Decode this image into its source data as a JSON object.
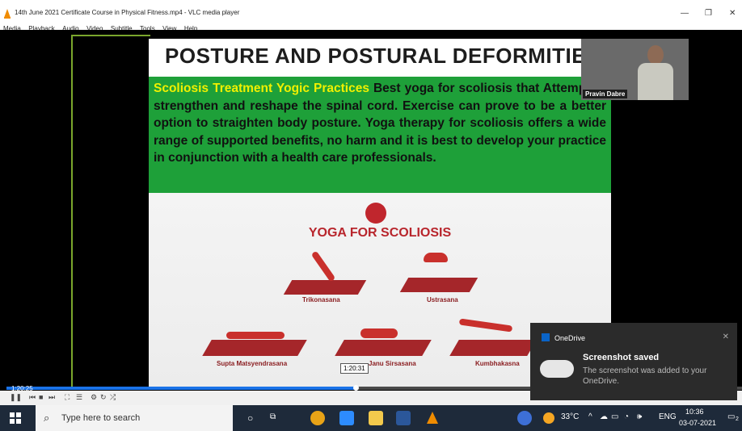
{
  "window": {
    "title": "14th June 2021 Certificate Course in Physical Fitness.mp4 - VLC media player",
    "controls": [
      "—",
      "❐",
      "✕"
    ]
  },
  "menu": [
    "Media",
    "Playback",
    "Audio",
    "Video",
    "Subtitle",
    "Tools",
    "View",
    "Help"
  ],
  "slide": {
    "heading": "POSTURE AND POSTURAL  DEFORMITIE",
    "highlight": "Scoliosis Treatment  Yogic Practices",
    "body": "  Best yoga for scoliosis that Attempt to strengthen and reshape the spinal cord. Exercise can prove to be a better option to straighten body posture. Yoga therapy for scoliosis offers a wide range of supported benefits, no harm and it is best to develop your practice in conjunction with a health care professionals.",
    "poster_title": "YOGA FOR SCOLIOSIS",
    "poses": [
      "Trikonasana",
      "Ustrasana",
      "Supta Matsyendrasana",
      "Janu Sirsasana",
      "Kumbhakasna"
    ]
  },
  "participant": {
    "name": "Pravin Dabre"
  },
  "player": {
    "current_time": "1:20:25",
    "hover_time": "1:20:31",
    "progress_fraction": 0.47
  },
  "taskbar": {
    "search_placeholder": "Type here to search",
    "temperature": "33°C",
    "language": "ENG",
    "time": "10:36",
    "date": "03-07-2021",
    "notification_count": "2"
  },
  "toast": {
    "app": "OneDrive",
    "heading": "Screenshot saved",
    "body": "The screenshot was added to your OneDrive."
  }
}
